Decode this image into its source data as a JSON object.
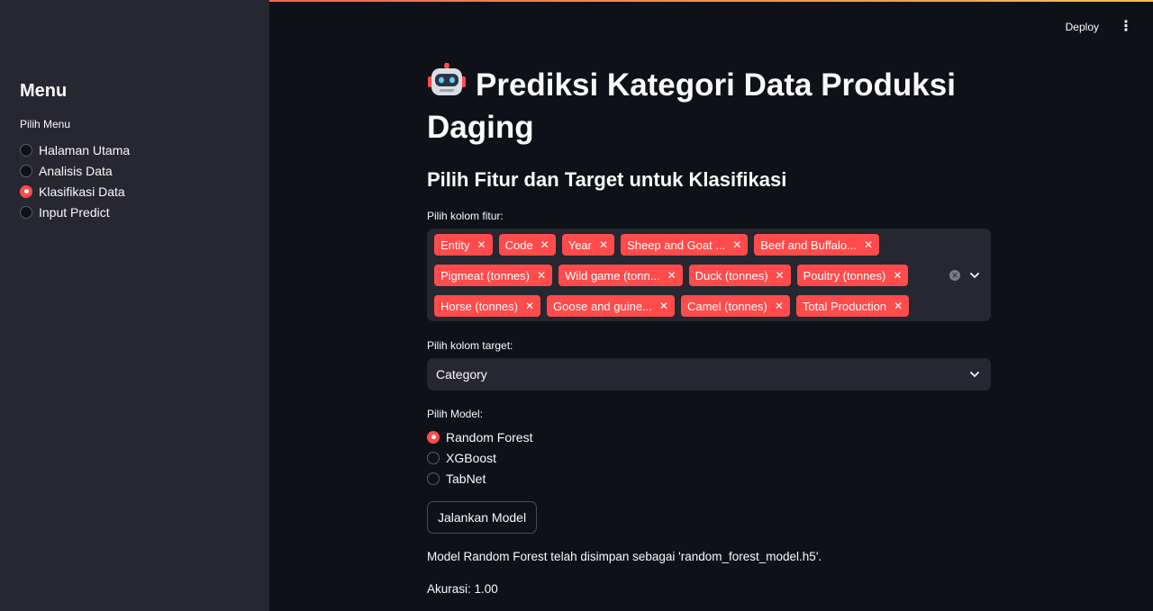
{
  "header": {
    "deploy_label": "Deploy",
    "menu_icon": "kebab-menu-icon"
  },
  "sidebar": {
    "title": "Menu",
    "radio_label": "Pilih Menu",
    "items": [
      {
        "label": "Halaman Utama",
        "selected": false
      },
      {
        "label": "Analisis Data",
        "selected": false
      },
      {
        "label": "Klasifikasi Data",
        "selected": true
      },
      {
        "label": "Input Predict",
        "selected": false
      }
    ]
  },
  "main": {
    "title": "Prediksi Kategori Data Produksi Daging",
    "title_icon": "robot-icon",
    "subtitle": "Pilih Fitur dan Target untuk Klasifikasi",
    "features_label": "Pilih kolom fitur:",
    "features": [
      "Entity",
      "Code",
      "Year",
      "Sheep and Goat ...",
      "Beef and Buffalo...",
      "Pigmeat (tonnes)",
      "Wild game (tonn...",
      "Duck (tonnes)",
      "Poultry (tonnes)",
      "Horse (tonnes)",
      "Goose and guine...",
      "Camel (tonnes)",
      "Total Production"
    ],
    "target_label": "Pilih kolom target:",
    "target_value": "Category",
    "model_label": "Pilih Model:",
    "models": [
      {
        "label": "Random Forest",
        "selected": true
      },
      {
        "label": "XGBoost",
        "selected": false
      },
      {
        "label": "TabNet",
        "selected": false
      }
    ],
    "run_button": "Jalankan Model",
    "saved_message": "Model Random Forest telah disimpan sebagai 'random_forest_model.h5'.",
    "accuracy_text": "Akurasi: 1.00"
  },
  "colors": {
    "accent": "#ff4b4b",
    "background": "#0e1117",
    "sidebar": "#262730"
  }
}
